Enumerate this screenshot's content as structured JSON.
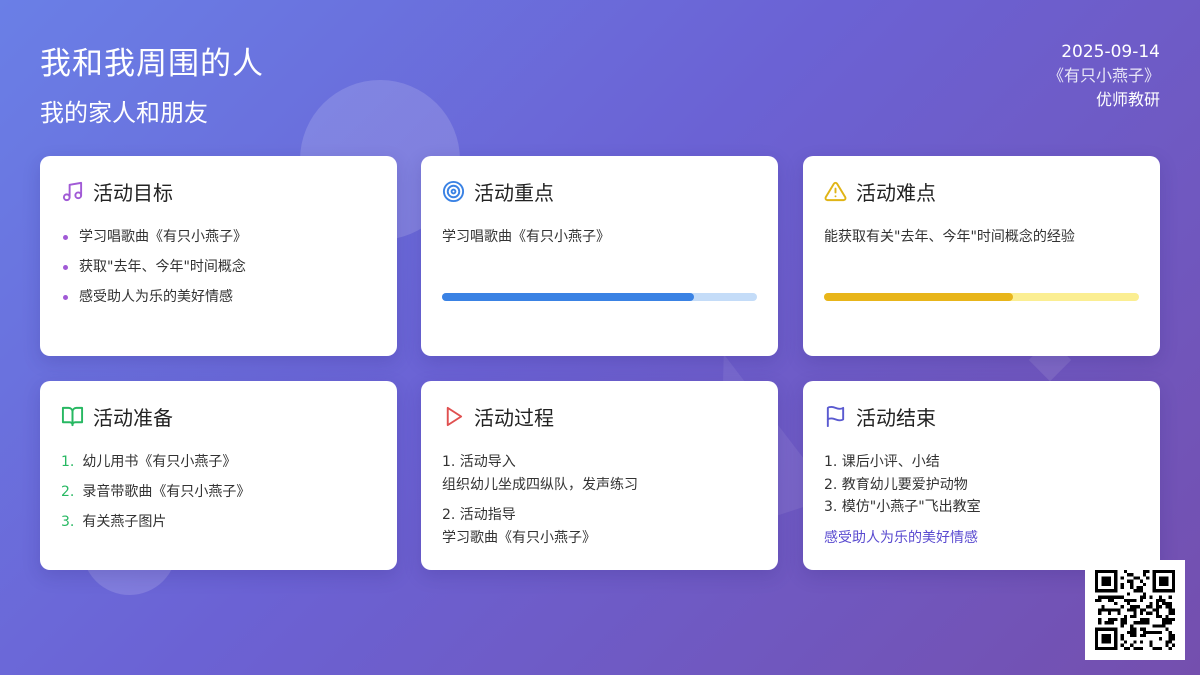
{
  "header": {
    "title": "我和我周围的人",
    "subtitle": "我的家人和朋友",
    "date": "2025-09-14",
    "song": "《有只小燕子》",
    "author": "优师教研"
  },
  "cards": {
    "goals": {
      "title": "活动目标",
      "icon": "music-note-icon",
      "items": [
        "学习唱歌曲《有只小燕子》",
        "获取\"去年、今年\"时间概念",
        "感受助人为乐的美好情感"
      ]
    },
    "focus": {
      "title": "活动重点",
      "icon": "target-icon",
      "text": "学习唱歌曲《有只小燕子》",
      "progress": 0.8
    },
    "difficulty": {
      "title": "活动难点",
      "icon": "warning-icon",
      "text": "能获取有关\"去年、今年\"时间概念的经验",
      "progress": 0.6
    },
    "prep": {
      "title": "活动准备",
      "icon": "book-icon",
      "items": [
        {
          "num": "1.",
          "text": "幼儿用书《有只小燕子》"
        },
        {
          "num": "2.",
          "text": "录音带歌曲《有只小燕子》"
        },
        {
          "num": "3.",
          "text": "有关燕子图片"
        }
      ]
    },
    "process": {
      "title": "活动过程",
      "icon": "play-icon",
      "steps": [
        {
          "head": "1. 活动导入",
          "body": "组织幼儿坐成四纵队，发声练习"
        },
        {
          "head": "2. 活动指导",
          "body": "学习歌曲《有只小燕子》"
        }
      ]
    },
    "ending": {
      "title": "活动结束",
      "icon": "flag-icon",
      "items": [
        "1. 课后小评、小结",
        "2. 教育幼儿要爱护动物",
        "3. 模仿\"小燕子\"飞出教室"
      ],
      "note": "感受助人为乐的美好情感"
    }
  },
  "colors": {
    "goals_icon": "#a15ad6",
    "focus_icon": "#3a82e4",
    "difficulty_icon": "#e0b416",
    "prep_icon": "#27b862",
    "process_icon": "#e05050",
    "ending_icon": "#5a5ad0"
  }
}
